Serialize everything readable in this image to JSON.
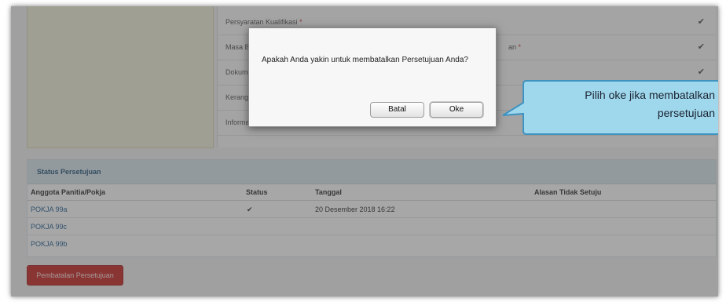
{
  "requirements": {
    "items": [
      {
        "label": "Persyaratan Kualifikasi",
        "required_mark": "*",
        "check": "✔"
      },
      {
        "label": "Masa Berlaku Penawaran",
        "required_mark": "*",
        "check": "✔"
      },
      {
        "label": "Dokumen Penawaran",
        "required_mark": "",
        "check": "✔"
      },
      {
        "label": "Kerangka Acuan Kerja",
        "required_mark": "",
        "check": ""
      },
      {
        "label": "Informasi Lainnya",
        "required_mark": "",
        "check": ""
      }
    ],
    "partial_text_row2": "an",
    "partial_mark_row2": "*"
  },
  "status": {
    "title": "Status Persetujuan",
    "columns": [
      "Anggota Panitia/Pokja",
      "Status",
      "Tanggal",
      "Alasan Tidak Setuju"
    ],
    "rows": [
      {
        "member": "POKJA 99a",
        "status": "✔",
        "date": "20 Desember 2018 16:22",
        "reason": ""
      },
      {
        "member": "POKJA 99c",
        "status": "",
        "date": "",
        "reason": ""
      },
      {
        "member": "POKJA 99b",
        "status": "",
        "date": "",
        "reason": ""
      }
    ]
  },
  "cancel_approval_button": "Pembatalan Persetujuan",
  "dialog": {
    "message": "Apakah Anda yakin untuk membatalkan Persetujuan Anda?",
    "cancel_label": "Batal",
    "ok_label": "Oke"
  },
  "callout": {
    "line1": "Pilih oke jika membatalkan",
    "line2": "persetujuan"
  },
  "colors": {
    "accent_red": "#c9302c",
    "callout_fill": "#9fd7ec",
    "link_blue": "#2a6496",
    "header_blue": "#dbe7ef"
  }
}
